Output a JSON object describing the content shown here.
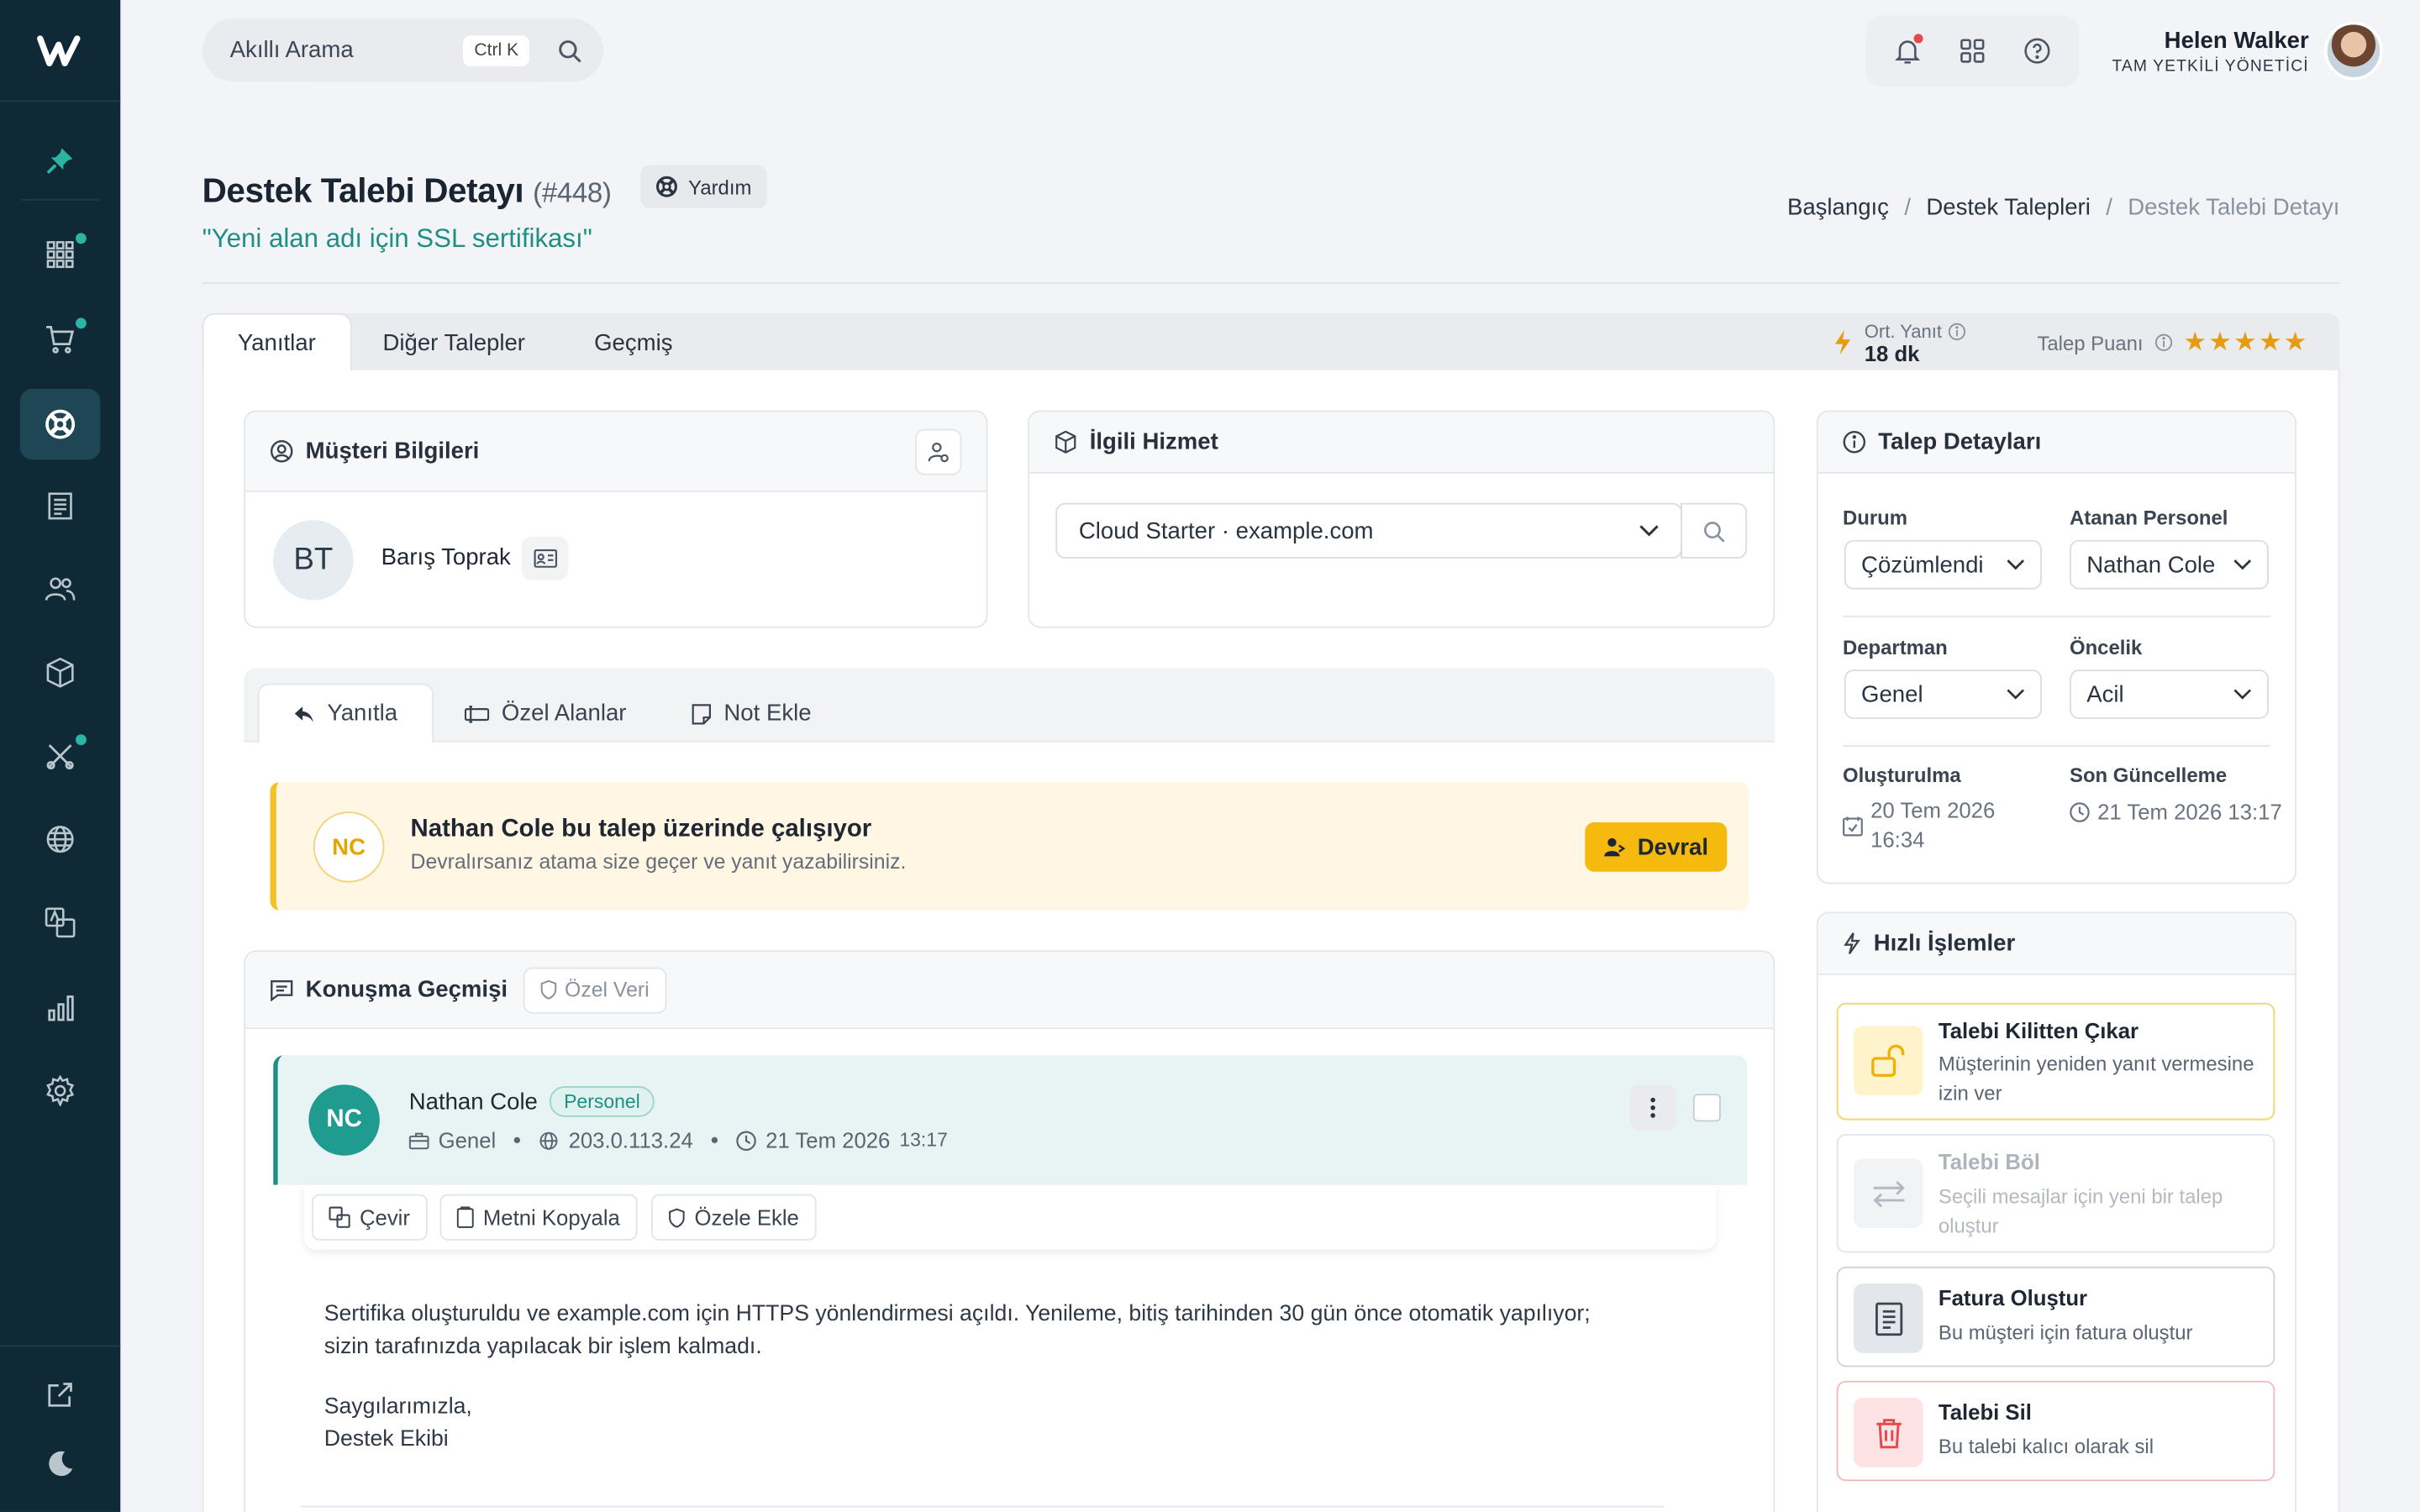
{
  "search": {
    "placeholder": "Akıllı Arama",
    "shortcut": "Ctrl K"
  },
  "user": {
    "name": "Helen Walker",
    "role": "TAM YETKİLİ YÖNETİCİ"
  },
  "header": {
    "title": "Destek Talebi Detayı",
    "ticket_number": "(#448)",
    "help_label": "Yardım",
    "subtitle": "\"Yeni alan adı için SSL sertifikası\""
  },
  "breadcrumb": [
    "Başlangıç",
    "Destek Talepleri",
    "Destek Talebi Detayı"
  ],
  "tabs": [
    "Yanıtlar",
    "Diğer Talepler",
    "Geçmiş"
  ],
  "metrics": {
    "avg_label": "Ort. Yanıt",
    "avg_value": "18 dk",
    "score_label": "Talep Puanı",
    "stars": 5
  },
  "customer": {
    "title": "Müşteri Bilgileri",
    "initials": "BT",
    "name": "Barış Toprak"
  },
  "service": {
    "title": "İlgili Hizmet",
    "selected": "Cloud Starter · example.com"
  },
  "details": {
    "title": "Talep Detayları",
    "status_label": "Durum",
    "status": "Çözümlendi",
    "staff_label": "Atanan Personel",
    "staff": "Nathan Cole",
    "dept_label": "Departman",
    "dept": "Genel",
    "priority_label": "Öncelik",
    "priority": "Acil",
    "created_label": "Oluşturulma",
    "created": "20 Tem 2026 16:34",
    "updated_label": "Son Güncelleme",
    "updated": "21 Tem 2026 13:17"
  },
  "reply_tabs": [
    "Yanıtla",
    "Özel Alanlar",
    "Not Ekle"
  ],
  "notice": {
    "initials": "NC",
    "title": "Nathan Cole bu talep üzerinde çalışıyor",
    "subtitle": "Devralırsanız atama size geçer ve yanıt yazabilirsiniz.",
    "button": "Devral"
  },
  "conversation": {
    "title": "Konuşma Geçmişi",
    "private_label": "Özel Veri"
  },
  "message": {
    "initials": "NC",
    "author": "Nathan Cole",
    "badge": "Personel",
    "dept": "Genel",
    "ip": "203.0.113.24",
    "date": "21 Tem 2026",
    "time": "13:17",
    "tools": [
      "Çevir",
      "Metni Kopyala",
      "Özele Ekle"
    ],
    "body_line1": "Sertifika oluşturuldu ve example.com için HTTPS yönlendirmesi açıldı. Yenileme, bitiş tarihinden 30 gün önce otomatik yapılıyor;",
    "body_line2": "sizin tarafınızda yapılacak bir işlem kalmadı.",
    "body_line3": "Saygılarımızla,",
    "body_line4": "Destek Ekibi"
  },
  "quick_actions": {
    "title": "Hızlı İşlemler",
    "items": [
      {
        "title": "Talebi Kilitten Çıkar",
        "subtitle": "Müşterinin yeniden yanıt vermesine izin ver"
      },
      {
        "title": "Talebi Böl",
        "subtitle": "Seçili mesajlar için yeni bir talep oluştur"
      },
      {
        "title": "Fatura Oluştur",
        "subtitle": "Bu müşteri için fatura oluştur"
      },
      {
        "title": "Talebi Sil",
        "subtitle": "Bu talebi kalıcı olarak sil"
      }
    ]
  },
  "colors": {
    "sidebar": "#0f2a36",
    "accent": "#1f8f84",
    "warning": "#f6b90d",
    "danger": "#e5484d",
    "stars": "#e59c10"
  }
}
